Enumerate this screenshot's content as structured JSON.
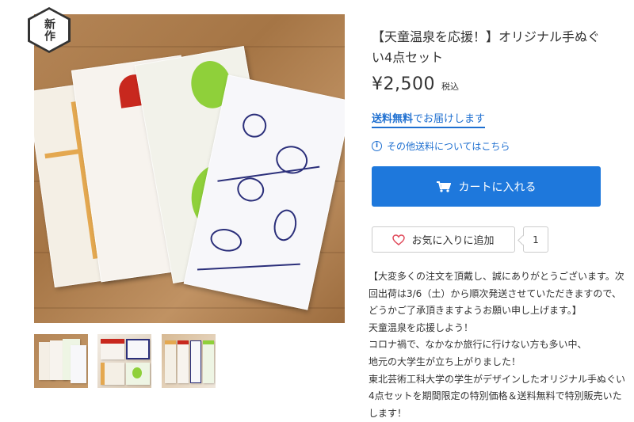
{
  "badge": {
    "text": "新作"
  },
  "product": {
    "title": "【天童温泉を応援！】オリジナル手ぬぐい4点セット",
    "price": "¥2,500",
    "tax_label": "税込"
  },
  "shipping": {
    "free_label": "送料無料",
    "deliver_text": "でお届けします",
    "other_shipping_link": "その他送料についてはこちら"
  },
  "actions": {
    "cart_label": "カートに入れる",
    "favorite_label": "お気に入りに追加",
    "favorite_count": "1"
  },
  "description": {
    "lines": [
      "【大変多くの注文を頂戴し、誠にありがとうございます。次回出荷は3/6（土）から順次発送させていただきますので、どうかご了承頂きますようお願い申し上げます。】",
      "天童温泉を応援しよう！",
      "コロナ禍で、なかなか旅行に行けない方も多い中、",
      "地元の大学生が立ち上がりました！",
      "東北芸術工科大学の学生がデザインしたオリジナル手ぬぐい4点セットを期間限定の特別価格＆送料無料で特別販売いたします！"
    ]
  },
  "colors": {
    "accent": "#1e78dc",
    "link": "#1e6fd0"
  },
  "icons": {
    "info": "info-icon",
    "cart": "cart-icon",
    "heart": "heart-icon"
  }
}
